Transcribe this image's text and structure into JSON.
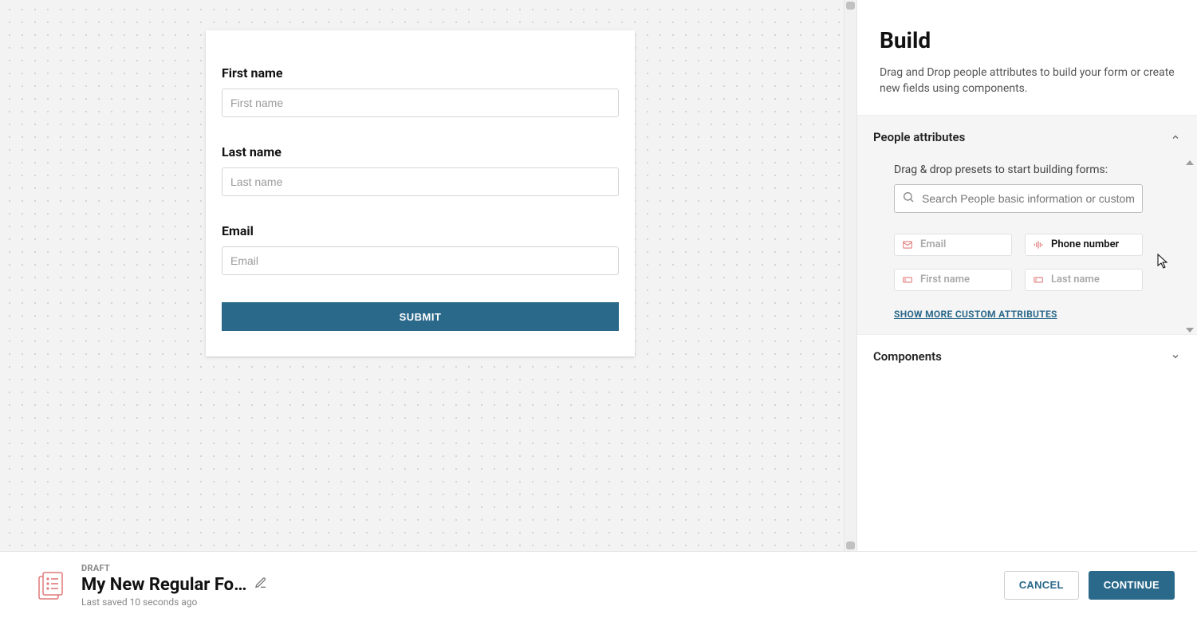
{
  "form": {
    "fields": [
      {
        "label": "First name",
        "placeholder": "First name"
      },
      {
        "label": "Last name",
        "placeholder": "Last name"
      },
      {
        "label": "Email",
        "placeholder": "Email"
      }
    ],
    "submit_label": "SUBMIT"
  },
  "panel": {
    "title": "Build",
    "subtitle": "Drag and Drop people attributes to build your form or create new fields using components.",
    "sections": {
      "people": {
        "label": "People attributes",
        "hint": "Drag & drop presets to start building forms:",
        "search_placeholder": "Search People basic information or custom ...",
        "chips": [
          {
            "label": "Email",
            "icon": "envelope",
            "used": true
          },
          {
            "label": "Phone number",
            "icon": "bars",
            "used": false
          },
          {
            "label": "First name",
            "icon": "text",
            "used": true
          },
          {
            "label": "Last name",
            "icon": "text",
            "used": true
          }
        ],
        "more_link": "SHOW MORE CUSTOM ATTRIBUTES"
      },
      "components": {
        "label": "Components"
      }
    }
  },
  "footer": {
    "status": "DRAFT",
    "title": "My New Regular Fo…",
    "saved": "Last saved 10 seconds ago",
    "cancel_label": "CANCEL",
    "continue_label": "CONTINUE"
  }
}
